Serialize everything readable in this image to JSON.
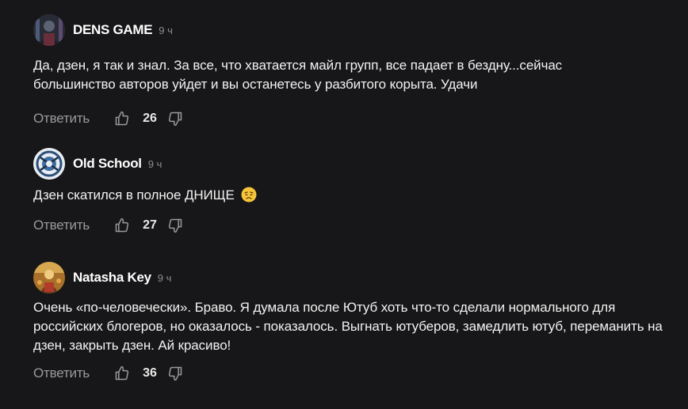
{
  "comments": [
    {
      "author": "DENS GAME",
      "time": "9 ч",
      "text": "Да, дзен, я так и знал. За все, что хватается майл групп, все падает в бездну...сейчас большинство авторов уйдет и вы останетесь у разбитого корыта. Удачи",
      "reply_label": "Ответить",
      "likes": "26",
      "avatar_icon": "avatar-dark-figure"
    },
    {
      "author": "Old School",
      "time": "9 ч",
      "text": "Дзен скатился в полное ДНИЩЕ",
      "emoji": "disappointed-face-icon",
      "reply_label": "Ответить",
      "likes": "27",
      "avatar_icon": "avatar-emblem"
    },
    {
      "author": "Natasha Key",
      "time": "9 ч",
      "text": "Очень «по-человечески». Браво. Я думала после Ютуб хоть что-то сделали нормального для российских блогеров, но оказалось - показалось. Выгнать ютуберов, замедлить ютуб, переманить на дзен, закрыть дзен. Ай красиво!",
      "reply_label": "Ответить",
      "likes": "36",
      "avatar_icon": "avatar-warm-illustration"
    }
  ],
  "colors": {
    "background": "#171719",
    "text": "#f2f2f2",
    "muted": "#8d8d91",
    "icon": "#9a9a9e"
  }
}
